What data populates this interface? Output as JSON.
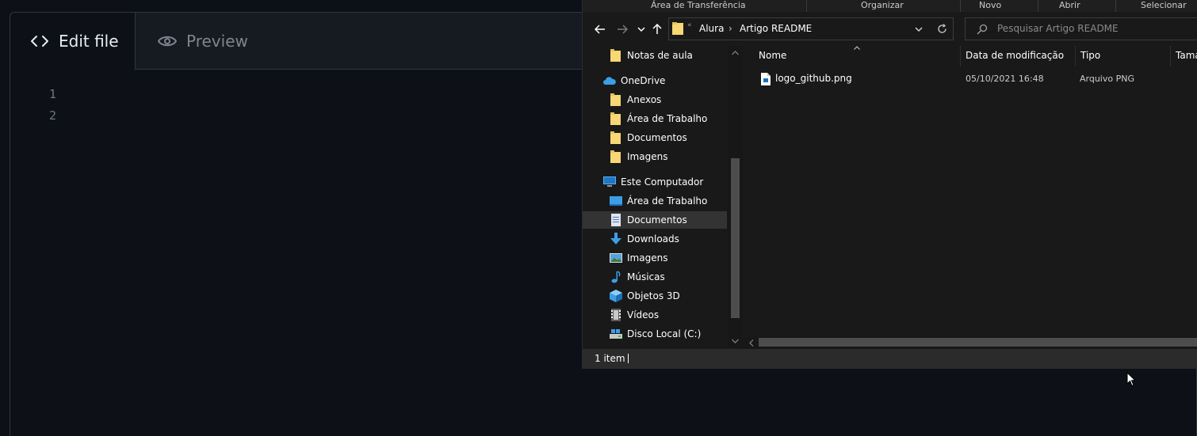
{
  "github": {
    "tabs": [
      {
        "label": "Edit file",
        "icon": "code-icon",
        "active": true
      },
      {
        "label": "Preview",
        "icon": "eye-icon",
        "active": false
      }
    ],
    "line_numbers": [
      "1",
      "2"
    ]
  },
  "explorer": {
    "ribbon": {
      "groups": [
        "Área de Transferência",
        "Organizar",
        "Novo",
        "Abrir",
        "Selecionar"
      ]
    },
    "address": {
      "overflow": "«",
      "crumbs": [
        "Alura",
        "Artigo README"
      ]
    },
    "search": {
      "placeholder": "Pesquisar Artigo README"
    },
    "nav": {
      "items": [
        {
          "label": "Notas de aula",
          "icon": "folder-icon"
        },
        {
          "label": "OneDrive",
          "icon": "onedrive-icon"
        },
        {
          "label": "Anexos",
          "icon": "folder-icon"
        },
        {
          "label": "Área de Trabalho",
          "icon": "folder-icon"
        },
        {
          "label": "Documentos",
          "icon": "folder-icon"
        },
        {
          "label": "Imagens",
          "icon": "folder-icon"
        },
        {
          "label": "Este Computador",
          "icon": "computer-icon"
        },
        {
          "label": "Área de Trabalho",
          "icon": "desktop-icon"
        },
        {
          "label": "Documentos",
          "icon": "documents-icon",
          "selected": true
        },
        {
          "label": "Downloads",
          "icon": "download-icon"
        },
        {
          "label": "Imagens",
          "icon": "pictures-icon"
        },
        {
          "label": "Músicas",
          "icon": "music-icon"
        },
        {
          "label": "Objetos 3D",
          "icon": "3d-objects-icon"
        },
        {
          "label": "Vídeos",
          "icon": "videos-icon"
        },
        {
          "label": "Disco Local (C:)",
          "icon": "drive-icon"
        }
      ]
    },
    "columns": [
      "Nome",
      "Data de modificação",
      "Tipo",
      "Tama"
    ],
    "files": [
      {
        "name": "logo_github.png",
        "modified": "05/10/2021 16:48",
        "type": "Arquivo PNG",
        "icon": "png-file-icon"
      }
    ],
    "status": {
      "count": "1 item"
    }
  },
  "colors": {
    "gh_bg": "#0d1117",
    "gh_border": "#30363d",
    "explorer_bg": "#191919",
    "selected": "#333333",
    "folder_yellow": "#f8d775",
    "onedrive_blue": "#3c9fe6"
  }
}
